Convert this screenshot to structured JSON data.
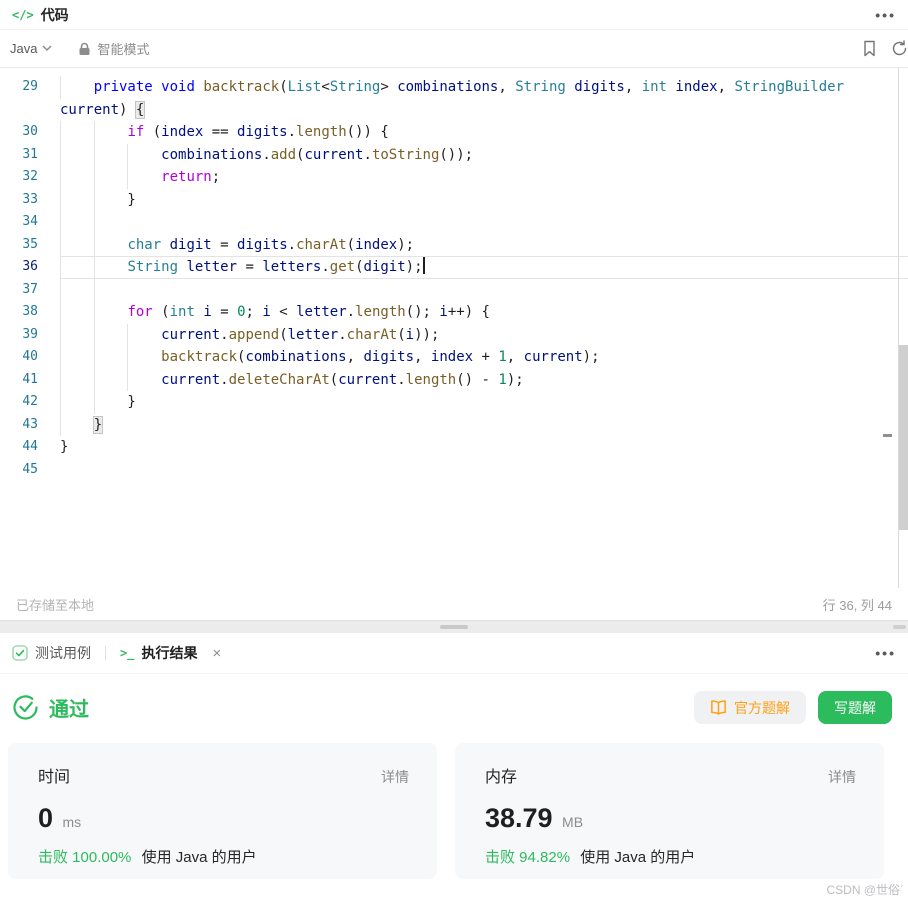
{
  "header": {
    "title": "代码",
    "menu": "•••"
  },
  "toolbar": {
    "language": "Java",
    "mode": "智能模式"
  },
  "editor": {
    "status_left": "已存储至本地",
    "status_right": "行 36, 列 44",
    "lines": [
      {
        "num": "29",
        "guides": [
          0
        ],
        "tokens": [
          [
            "    ",
            "p"
          ],
          [
            "private",
            "k"
          ],
          [
            " ",
            "p"
          ],
          [
            "void",
            "k"
          ],
          [
            " ",
            "p"
          ],
          [
            "backtrack",
            "f"
          ],
          [
            "(",
            "p"
          ],
          [
            "List",
            "t"
          ],
          [
            "<",
            "p"
          ],
          [
            "String",
            "t"
          ],
          [
            "> ",
            "p"
          ],
          [
            "combinations",
            "v"
          ],
          [
            ", ",
            "p"
          ],
          [
            "String",
            "t"
          ],
          [
            " ",
            "p"
          ],
          [
            "digits",
            "v"
          ],
          [
            ", ",
            "p"
          ],
          [
            "int",
            "t"
          ],
          [
            " ",
            "p"
          ],
          [
            "index",
            "v"
          ],
          [
            ", ",
            "p"
          ],
          [
            "StringBuilder",
            "t"
          ]
        ]
      },
      {
        "num": "",
        "guides": [],
        "tokens": [
          [
            "current",
            "v"
          ],
          [
            ") ",
            "p"
          ],
          [
            "{",
            "p",
            1
          ]
        ]
      },
      {
        "num": "30",
        "guides": [
          0,
          1
        ],
        "tokens": [
          [
            "        ",
            "p"
          ],
          [
            "if",
            "c"
          ],
          [
            " (",
            "p"
          ],
          [
            "index",
            "v"
          ],
          [
            " == ",
            "p"
          ],
          [
            "digits",
            "v"
          ],
          [
            ".",
            "p"
          ],
          [
            "length",
            "f"
          ],
          [
            "()) {",
            "p"
          ]
        ]
      },
      {
        "num": "31",
        "guides": [
          0,
          1,
          2
        ],
        "tokens": [
          [
            "            ",
            "p"
          ],
          [
            "combinations",
            "v"
          ],
          [
            ".",
            "p"
          ],
          [
            "add",
            "f"
          ],
          [
            "(",
            "p"
          ],
          [
            "current",
            "v"
          ],
          [
            ".",
            "p"
          ],
          [
            "toString",
            "f"
          ],
          [
            "());",
            "p"
          ]
        ]
      },
      {
        "num": "32",
        "guides": [
          0,
          1,
          2
        ],
        "tokens": [
          [
            "            ",
            "p"
          ],
          [
            "return",
            "c"
          ],
          [
            ";",
            "p"
          ]
        ]
      },
      {
        "num": "33",
        "guides": [
          0,
          1
        ],
        "tokens": [
          [
            "        }",
            "p"
          ]
        ]
      },
      {
        "num": "34",
        "guides": [
          0,
          1
        ],
        "tokens": []
      },
      {
        "num": "35",
        "guides": [
          0,
          1
        ],
        "tokens": [
          [
            "        ",
            "p"
          ],
          [
            "char",
            "t"
          ],
          [
            " ",
            "p"
          ],
          [
            "digit",
            "v"
          ],
          [
            " = ",
            "p"
          ],
          [
            "digits",
            "v"
          ],
          [
            ".",
            "p"
          ],
          [
            "charAt",
            "f"
          ],
          [
            "(",
            "p"
          ],
          [
            "index",
            "v"
          ],
          [
            ");",
            "p"
          ]
        ]
      },
      {
        "num": "36",
        "guides": [
          0,
          1
        ],
        "current": true,
        "cursor": true,
        "tokens": [
          [
            "        ",
            "p"
          ],
          [
            "String",
            "t"
          ],
          [
            " ",
            "p"
          ],
          [
            "letter",
            "v"
          ],
          [
            " = ",
            "p"
          ],
          [
            "letters",
            "v"
          ],
          [
            ".",
            "p"
          ],
          [
            "get",
            "f"
          ],
          [
            "(",
            "p"
          ],
          [
            "digit",
            "v"
          ],
          [
            ");",
            "p"
          ]
        ]
      },
      {
        "num": "37",
        "guides": [
          0,
          1
        ],
        "tokens": []
      },
      {
        "num": "38",
        "guides": [
          0,
          1
        ],
        "tokens": [
          [
            "        ",
            "p"
          ],
          [
            "for",
            "c"
          ],
          [
            " (",
            "p"
          ],
          [
            "int",
            "t"
          ],
          [
            " ",
            "p"
          ],
          [
            "i",
            "v"
          ],
          [
            " = ",
            "p"
          ],
          [
            "0",
            "n"
          ],
          [
            "; ",
            "p"
          ],
          [
            "i",
            "v"
          ],
          [
            " < ",
            "p"
          ],
          [
            "letter",
            "v"
          ],
          [
            ".",
            "p"
          ],
          [
            "length",
            "f"
          ],
          [
            "(); ",
            "p"
          ],
          [
            "i",
            "v"
          ],
          [
            "++) {",
            "p"
          ]
        ]
      },
      {
        "num": "39",
        "guides": [
          0,
          1,
          2
        ],
        "tokens": [
          [
            "            ",
            "p"
          ],
          [
            "current",
            "v"
          ],
          [
            ".",
            "p"
          ],
          [
            "append",
            "f"
          ],
          [
            "(",
            "p"
          ],
          [
            "letter",
            "v"
          ],
          [
            ".",
            "p"
          ],
          [
            "charAt",
            "f"
          ],
          [
            "(",
            "p"
          ],
          [
            "i",
            "v"
          ],
          [
            "));",
            "p"
          ]
        ]
      },
      {
        "num": "40",
        "guides": [
          0,
          1,
          2
        ],
        "tokens": [
          [
            "            ",
            "p"
          ],
          [
            "backtrack",
            "f"
          ],
          [
            "(",
            "p"
          ],
          [
            "combinations",
            "v"
          ],
          [
            ", ",
            "p"
          ],
          [
            "digits",
            "v"
          ],
          [
            ", ",
            "p"
          ],
          [
            "index",
            "v"
          ],
          [
            " + ",
            "p"
          ],
          [
            "1",
            "n"
          ],
          [
            ", ",
            "p"
          ],
          [
            "current",
            "v"
          ],
          [
            ");",
            "p"
          ]
        ]
      },
      {
        "num": "41",
        "guides": [
          0,
          1,
          2
        ],
        "tokens": [
          [
            "            ",
            "p"
          ],
          [
            "current",
            "v"
          ],
          [
            ".",
            "p"
          ],
          [
            "deleteCharAt",
            "f"
          ],
          [
            "(",
            "p"
          ],
          [
            "current",
            "v"
          ],
          [
            ".",
            "p"
          ],
          [
            "length",
            "f"
          ],
          [
            "() - ",
            "p"
          ],
          [
            "1",
            "n"
          ],
          [
            ");",
            "p"
          ]
        ]
      },
      {
        "num": "42",
        "guides": [
          0,
          1
        ],
        "tokens": [
          [
            "        }",
            "p"
          ]
        ]
      },
      {
        "num": "43",
        "guides": [
          0
        ],
        "tokens": [
          [
            "    ",
            "p"
          ],
          [
            "}",
            "p",
            1
          ]
        ]
      },
      {
        "num": "44",
        "guides": [],
        "tokens": [
          [
            "}",
            "p"
          ]
        ]
      },
      {
        "num": "45",
        "guides": [],
        "tokens": []
      }
    ]
  },
  "console": {
    "menu": "•••",
    "tabs": [
      {
        "label": "测试用例"
      },
      {
        "label": "执行结果",
        "close": "×"
      }
    ],
    "result": {
      "status": "通过",
      "buttons": [
        {
          "label": "官方题解"
        },
        {
          "label": "写题解"
        }
      ],
      "cards": [
        {
          "title": "时间",
          "action": "详情",
          "value": "0",
          "unit": "ms",
          "beat": "击败 100.00%",
          "suffix": "使用 Java 的用户"
        },
        {
          "title": "内存",
          "action": "详情",
          "value": "38.79",
          "unit": "MB",
          "beat": "击败 94.82%",
          "suffix": "使用 Java 的用户"
        }
      ]
    }
  },
  "watermark": "CSDN @世俗´",
  "colors": {
    "accent_green": "#2cbb5d",
    "solution_orange": "#ffa116",
    "syntax": {
      "keyword": "#0000ff",
      "control": "#af00db",
      "type": "#267f99",
      "variable": "#001080",
      "function": "#795e26",
      "number": "#098658",
      "line_number": "#237893",
      "active_line_number": "#0b216f"
    }
  }
}
